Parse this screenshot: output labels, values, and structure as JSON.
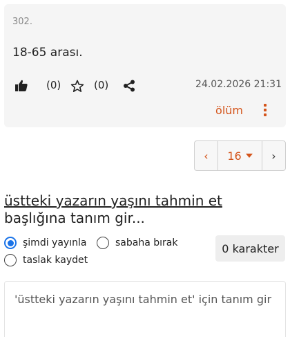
{
  "entry": {
    "number": "302.",
    "content": "18-65 arası.",
    "like_count": "(0)",
    "favorite_count": "(0)",
    "date": "24.02.2026 21:31",
    "author": "ölüm"
  },
  "pager": {
    "prev": "‹",
    "current": "16",
    "next": "›"
  },
  "topic": {
    "title": "üstteki yazarın yaşını tahmin et",
    "suffix": " başlığına tanım gir..."
  },
  "compose": {
    "publish_now": "şimdi yayınla",
    "leave_for_morning": "sabaha bırak",
    "save_draft": "taslak kaydet",
    "selected_option": "şimdi yayınla",
    "char_count": "0 karakter",
    "placeholder": "'üstteki yazarın yaşını tahmin et' için tanım gir"
  },
  "colors": {
    "accent": "#d4541a",
    "radio_selected": "#1a73e8"
  },
  "icons": [
    "thumbs-up-icon",
    "star-icon",
    "share-icon",
    "more-vertical-icon",
    "chevron-left-icon",
    "chevron-right-icon",
    "caret-down-icon"
  ]
}
